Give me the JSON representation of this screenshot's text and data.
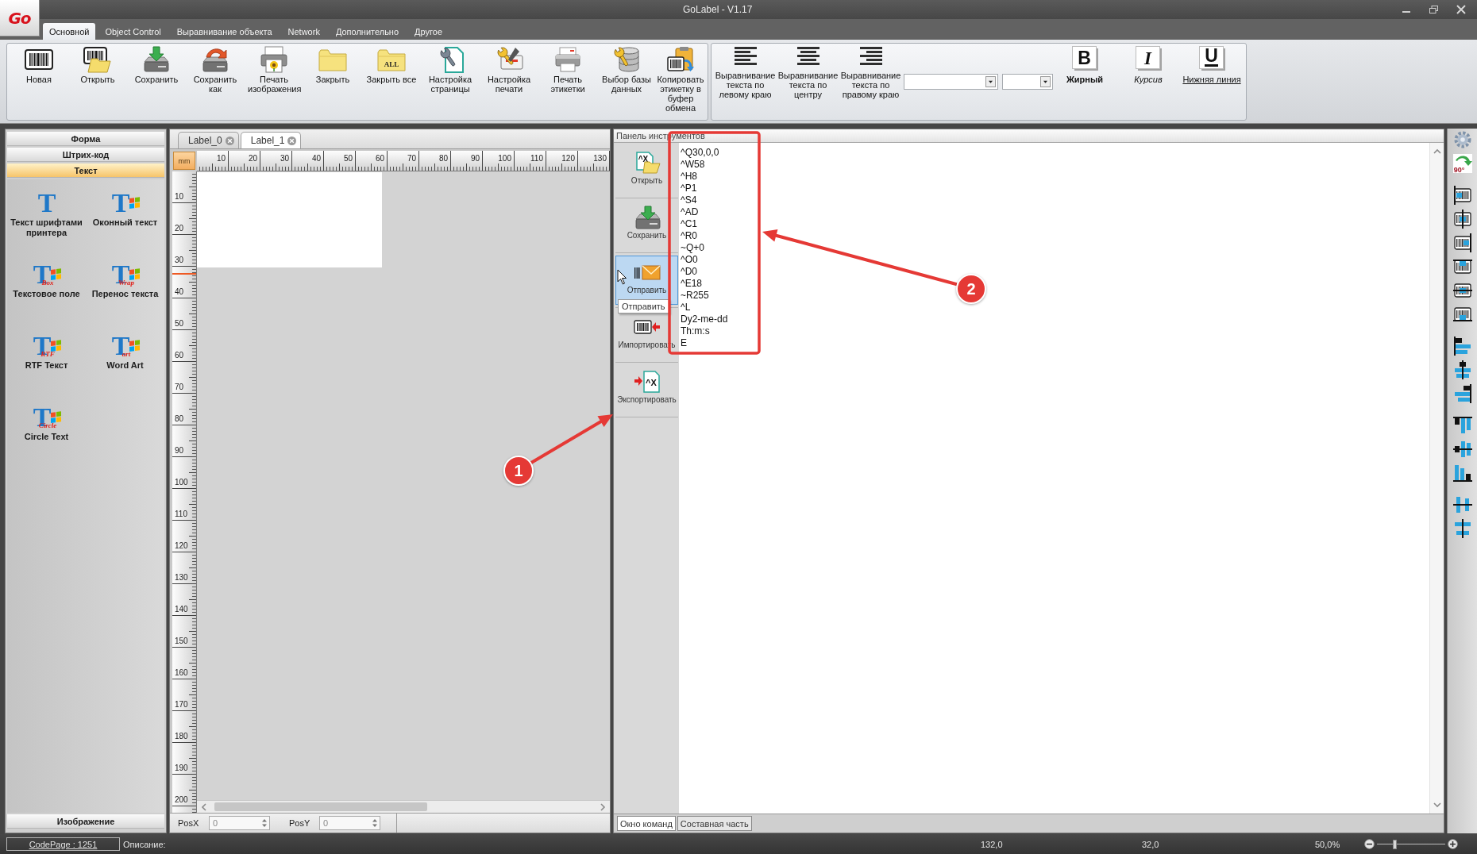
{
  "window": {
    "logo": "Go",
    "title": "GoLabel - V1.17"
  },
  "ribbon_tabs": [
    {
      "label": "Основной",
      "selected": true
    },
    {
      "label": "Object Control",
      "selected": false
    },
    {
      "label": "Выравнивание объекта",
      "selected": false
    },
    {
      "label": "Network",
      "selected": false
    },
    {
      "label": "Дополнительно",
      "selected": false
    },
    {
      "label": "Другое",
      "selected": false
    }
  ],
  "ribbon": {
    "file_buttons": [
      {
        "label": "Новая",
        "kind": "new"
      },
      {
        "label": "Открыть",
        "kind": "open"
      },
      {
        "label": "Сохранить",
        "kind": "save"
      },
      {
        "label": "Сохранить как",
        "kind": "saveas"
      },
      {
        "label": "Печать изображения",
        "kind": "printimage"
      },
      {
        "label": "Закрыть",
        "kind": "close"
      },
      {
        "label": "Закрыть все",
        "kind": "closeall",
        "badge": "ALL"
      },
      {
        "label": "Настройка страницы",
        "kind": "pagesetup"
      },
      {
        "label": "Настройка печати",
        "kind": "printsetup"
      },
      {
        "label": "Печать этикетки",
        "kind": "printlabel"
      },
      {
        "label": "Выбор базы данных",
        "kind": "database"
      },
      {
        "label": "Копировать этикетку в буфер обмена",
        "kind": "copy"
      }
    ],
    "align_buttons": [
      {
        "label": "Выравнивание текста по левому краю",
        "kind": "left"
      },
      {
        "label": "Выравнивание текста по центру",
        "kind": "center"
      },
      {
        "label": "Выравнивание текста по правому краю",
        "kind": "right"
      }
    ],
    "style_buttons": [
      {
        "label": "Жирный",
        "kind": "bold",
        "glyph": "B"
      },
      {
        "label": "Курсив",
        "kind": "italic",
        "glyph": "I"
      },
      {
        "label": "Нижняя линия",
        "kind": "underline",
        "glyph": "U"
      }
    ]
  },
  "left_panel": {
    "categories": [
      {
        "label": "Форма",
        "selected": false
      },
      {
        "label": "Штрих-код",
        "selected": false
      },
      {
        "label": "Текст",
        "selected": true
      },
      {
        "label": "Изображение",
        "selected": false
      }
    ],
    "tools": [
      {
        "label": "Текст шрифтами принтера",
        "kind": "printer",
        "glyph": "T"
      },
      {
        "label": "Оконный текст",
        "kind": "windows",
        "glyph": "T"
      },
      {
        "label": "Текстовое поле",
        "kind": "box",
        "glyph": "T",
        "tag": "Box"
      },
      {
        "label": "Перенос текста",
        "kind": "wrap",
        "glyph": "T",
        "tag": "Wrap"
      },
      {
        "label": "RTF Текст",
        "kind": "rtf",
        "glyph": "T",
        "tag": "RTF"
      },
      {
        "label": "Word Art",
        "kind": "art",
        "glyph": "T",
        "tag": "art"
      },
      {
        "label": "Circle Text",
        "kind": "circle",
        "glyph": "T",
        "tag": "Circle"
      }
    ]
  },
  "document_tabs": [
    {
      "label": "Label_0",
      "selected": false
    },
    {
      "label": "Label_1",
      "selected": true
    }
  ],
  "ruler": {
    "unit": "mm",
    "x_labels": [
      "10",
      "20",
      "30",
      "40",
      "50",
      "60",
      "70",
      "80",
      "90",
      "100",
      "110",
      "120",
      "130"
    ],
    "y_labels": [
      "10",
      "20",
      "30",
      "40",
      "50",
      "60",
      "70",
      "80",
      "90",
      "100",
      "110",
      "120",
      "130",
      "140",
      "150",
      "160",
      "170",
      "180",
      "190",
      "200"
    ]
  },
  "position_fields": [
    {
      "label": "PosX",
      "value": "0"
    },
    {
      "label": "PosY",
      "value": "0"
    }
  ],
  "tool_panel": {
    "title": "Панель инструментов",
    "buttons": [
      {
        "label": "Открыть",
        "kind": "open",
        "badge": "^X",
        "hovered": false
      },
      {
        "label": "Сохранить",
        "kind": "save",
        "hovered": false
      },
      {
        "label": "Отправить",
        "kind": "send",
        "hovered": true
      },
      {
        "label": "Импортировать",
        "kind": "import",
        "hovered": false
      },
      {
        "label": "Экспортировать",
        "kind": "export",
        "badge": "^X",
        "hovered": false
      }
    ],
    "tooltip": "Отправить",
    "command_lines": [
      "^Q30,0,0",
      "^W58",
      "^H8",
      "^P1",
      "^S4",
      "^AD",
      "^C1",
      "^R0",
      "~Q+0",
      "^O0",
      "^D0",
      "^E18",
      "~R255",
      "^L",
      "Dy2-me-dd",
      "Th:m:s",
      "E"
    ],
    "tabs": [
      {
        "label": "Окно команд",
        "selected": true
      },
      {
        "label": "Составная часть",
        "selected": false
      }
    ]
  },
  "right_toolbar": {
    "groups": [
      {
        "items": [
          {
            "kind": "settings"
          },
          {
            "kind": "rotate",
            "badge": "90°"
          }
        ]
      },
      {
        "items": [
          {
            "kind": "posleft"
          },
          {
            "kind": "poscenter"
          },
          {
            "kind": "posright"
          },
          {
            "kind": "postop"
          },
          {
            "kind": "posmiddle"
          },
          {
            "kind": "posbottom"
          }
        ]
      },
      {
        "items": [
          {
            "kind": "alignleft"
          },
          {
            "kind": "aligncenter"
          },
          {
            "kind": "alignright"
          }
        ]
      },
      {
        "items": [
          {
            "kind": "aligntop"
          },
          {
            "kind": "alignmiddle"
          },
          {
            "kind": "alignbottom"
          }
        ]
      },
      {
        "items": [
          {
            "kind": "spreadh"
          },
          {
            "kind": "spreadv"
          }
        ]
      }
    ]
  },
  "status_bar": {
    "code_page": "CodePage : 1251",
    "description_label": "Описание:",
    "value_1": "132,0",
    "value_2": "32,0",
    "zoom": {
      "reading": "50,0%",
      "level": 0.26
    }
  },
  "callouts": [
    {
      "number": "1"
    },
    {
      "number": "2"
    }
  ]
}
